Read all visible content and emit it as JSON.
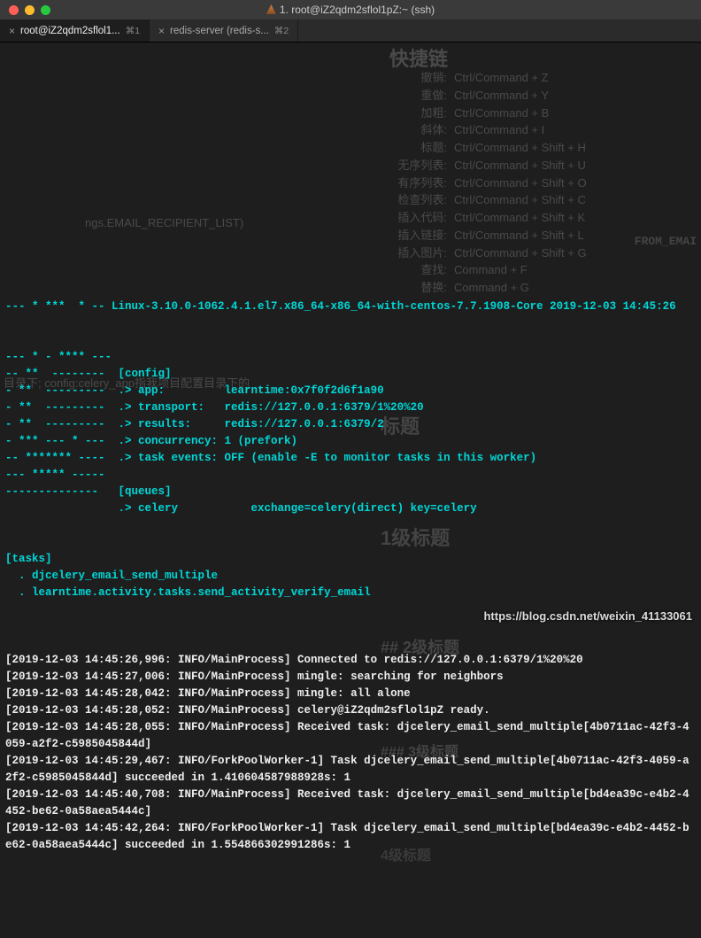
{
  "titlebar": {
    "title": "1. root@iZ2qdm2sflol1pZ:~ (ssh)"
  },
  "tabs": [
    {
      "label": "root@iZ2qdm2sflol1...",
      "shortcut": "⌘1",
      "active": true
    },
    {
      "label": "redis-server (redis-s...",
      "shortcut": "⌘2",
      "active": false
    }
  ],
  "ghost": {
    "title": "快捷链",
    "shortcuts": [
      {
        "k": "撤销:",
        "v": "Ctrl/Command + Z"
      },
      {
        "k": "重做:",
        "v": "Ctrl/Command + Y"
      },
      {
        "k": "加粗:",
        "v": "Ctrl/Command + B"
      },
      {
        "k": "斜体:",
        "v": "Ctrl/Command + I"
      },
      {
        "k": "标题:",
        "v": "Ctrl/Command + Shift + H"
      },
      {
        "k": "无序列表:",
        "v": "Ctrl/Command + Shift + U"
      },
      {
        "k": "有序列表:",
        "v": "Ctrl/Command + Shift + O"
      },
      {
        "k": "检查列表:",
        "v": "Ctrl/Command + Shift + C"
      },
      {
        "k": "插入代码:",
        "v": "Ctrl/Command + Shift + K"
      },
      {
        "k": "插入链接:",
        "v": "Ctrl/Command + Shift + L"
      },
      {
        "k": "插入图片:",
        "v": "Ctrl/Command + Shift + G"
      },
      {
        "k": "查找:",
        "v": "Command + F"
      },
      {
        "k": "替换:",
        "v": "Command + G"
      }
    ],
    "email_hint": "ngs.EMAIL_RECIPIENT_LIST)",
    "from_email": "FROM_EMAI",
    "config_hint": "目录下; config:celery_app指我项目配置目录下的",
    "headings_section": "标题",
    "headings": [
      "1级标题",
      "## 2级标题",
      "### 3级标题",
      "4级标题"
    ]
  },
  "terminal": {
    "banner": "--- * ***  * -- Linux-3.10.0-1062.4.1.el7.x86_64-x86_64-with-centos-7.7.1908-Core 2019-12-03 14:45:26",
    "art": [
      "--- * - **** ---",
      "-- **  --------  [config]",
      "- **  ---------  .> app:         learntime:0x7f0f2d6f1a90",
      "- **  ---------  .> transport:   redis://127.0.0.1:6379/1%20%20",
      "- **  ---------  .> results:     redis://127.0.0.1:6379/2",
      "- *** --- * ---  .> concurrency: 1 (prefork)",
      "-- ******* ----  .> task events: OFF (enable -E to monitor tasks in this worker)",
      "--- ***** -----",
      "--------------   [queues]",
      "                 .> celery           exchange=celery(direct) key=celery",
      "",
      "",
      "[tasks]",
      "  . djcelery_email_send_multiple",
      "  . learntime.activity.tasks.send_activity_verify_email",
      ""
    ],
    "logs": [
      "[2019-12-03 14:45:26,996: INFO/MainProcess] Connected to redis://127.0.0.1:6379/1%20%20",
      "[2019-12-03 14:45:27,006: INFO/MainProcess] mingle: searching for neighbors",
      "[2019-12-03 14:45:28,042: INFO/MainProcess] mingle: all alone",
      "[2019-12-03 14:45:28,052: INFO/MainProcess] celery@iZ2qdm2sflol1pZ ready.",
      "[2019-12-03 14:45:28,055: INFO/MainProcess] Received task: djcelery_email_send_multiple[4b0711ac-42f3-4059-a2f2-c5985045844d]",
      "[2019-12-03 14:45:29,467: INFO/ForkPoolWorker-1] Task djcelery_email_send_multiple[4b0711ac-42f3-4059-a2f2-c5985045844d] succeeded in 1.410604587988928s: 1",
      "[2019-12-03 14:45:40,708: INFO/MainProcess] Received task: djcelery_email_send_multiple[bd4ea39c-e4b2-4452-be62-0a58aea5444c]",
      "[2019-12-03 14:45:42,264: INFO/ForkPoolWorker-1] Task djcelery_email_send_multiple[bd4ea39c-e4b2-4452-be62-0a58aea5444c] succeeded in 1.554866302991286s: 1"
    ]
  },
  "watermark": "https://blog.csdn.net/weixin_41133061"
}
